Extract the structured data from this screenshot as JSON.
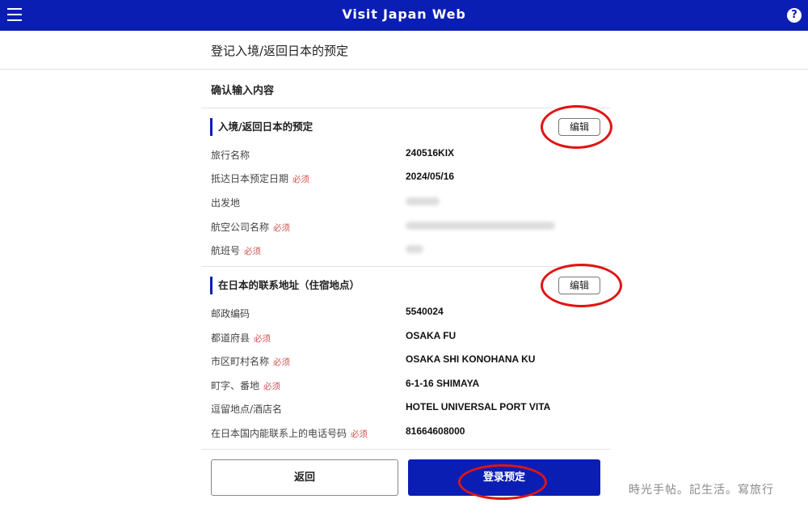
{
  "app": {
    "title": "Visit Japan Web",
    "help_icon": "?"
  },
  "page": {
    "heading": "登记入境/返回日本的预定",
    "confirm_heading": "确认输入内容"
  },
  "sections": [
    {
      "title": "入境/返回日本的预定",
      "edit_label": "编辑",
      "rows": [
        {
          "label": "旅行名称",
          "required": "",
          "value": "240516KIX"
        },
        {
          "label": "抵达日本预定日期",
          "required": "必须",
          "value": "2024/05/16"
        },
        {
          "label": "出发地",
          "required": "",
          "value": ""
        },
        {
          "label": "航空公司名称",
          "required": "必须",
          "value": ""
        },
        {
          "label": "航班号",
          "required": "必须",
          "value": ""
        }
      ]
    },
    {
      "title": "在日本的联系地址（住宿地点）",
      "edit_label": "编辑",
      "rows": [
        {
          "label": "邮政编码",
          "required": "",
          "value": "5540024"
        },
        {
          "label": "都道府县",
          "required": "必须",
          "value": "OSAKA FU"
        },
        {
          "label": "市区町村名称",
          "required": "必须",
          "value": "OSAKA SHI KONOHANA KU"
        },
        {
          "label": "町字、番地",
          "required": "必须",
          "value": "6-1-16 SHIMAYA"
        },
        {
          "label": "逗留地点/酒店名",
          "required": "",
          "value": "HOTEL UNIVERSAL PORT VITA"
        },
        {
          "label": "在日本国内能联系上的电话号码",
          "required": "必须",
          "value": "81664608000"
        }
      ]
    }
  ],
  "buttons": {
    "back": "返回",
    "submit": "登录预定"
  },
  "watermark": "時光手帖。記生活。寫旅行",
  "colors": {
    "brand": "#0a1eb4",
    "annotation": "#e01414",
    "required": "#d05050"
  }
}
